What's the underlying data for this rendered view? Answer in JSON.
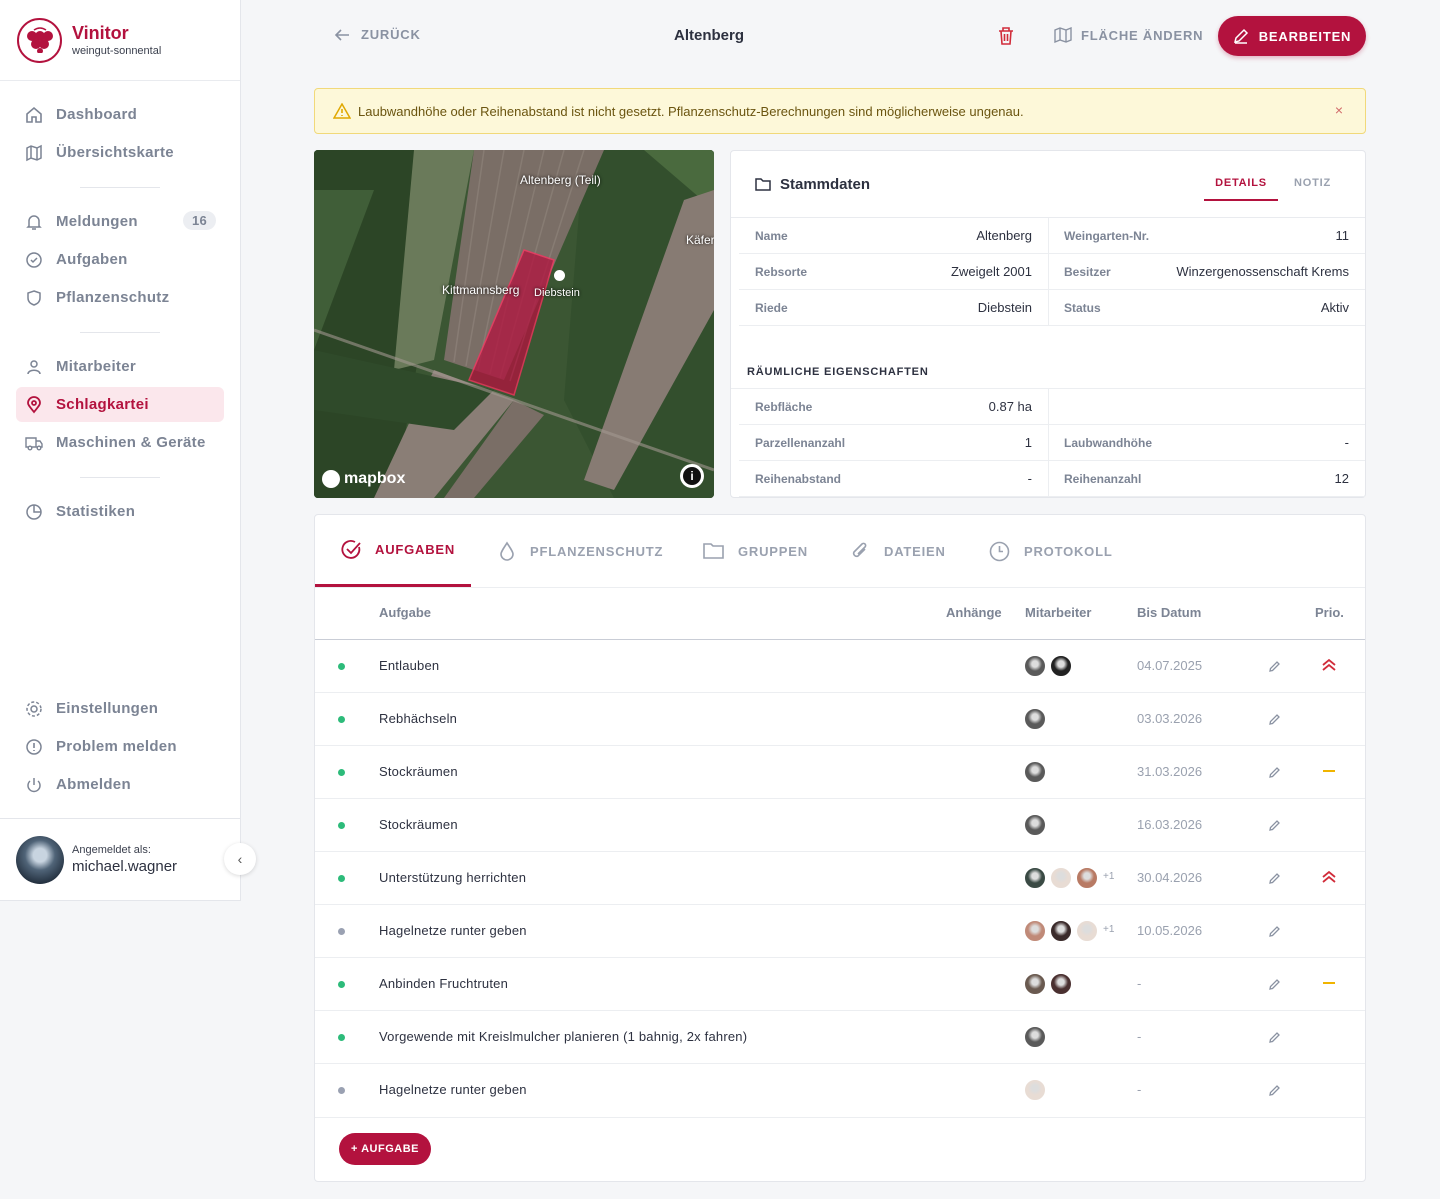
{
  "brand": {
    "name": "Vinitor",
    "sub": "weingut-sonnental"
  },
  "nav": {
    "dashboard": "Dashboard",
    "map": "Übersichtskarte",
    "meldungen": "Meldungen",
    "meldungen_count": "16",
    "aufgaben": "Aufgaben",
    "pflanzenschutz": "Pflanzenschutz",
    "mitarbeiter": "Mitarbeiter",
    "schlagkartei": "Schlagkartei",
    "maschinen": "Maschinen & Geräte",
    "statistiken": "Statistiken",
    "einstellungen": "Einstellungen",
    "problem": "Problem melden",
    "abmelden": "Abmelden"
  },
  "user": {
    "label": "Angemeldet als:",
    "name": "michael.wagner"
  },
  "topbar": {
    "back": "ZURÜCK",
    "title": "Altenberg",
    "change_area": "FLÄCHE ÄNDERN",
    "edit": "BEARBEITEN"
  },
  "warning": {
    "text": "Laubwandhöhe oder Reihenabstand ist nicht gesetzt. Pflanzenschutz-Berechnungen sind möglicherweise ungenau.",
    "close": "×"
  },
  "map": {
    "labels": {
      "altenberg": "Altenberg (Teil)",
      "kittmannsberg": "Kittmannsberg",
      "diebstein": "Diebstein",
      "kafer": "Käfer"
    },
    "attribution": "mapbox",
    "info": "i"
  },
  "stammdaten": {
    "title": "Stammdaten",
    "tab_details": "DETAILS",
    "tab_notiz": "NOTIZ",
    "rows_left": [
      {
        "k": "Name",
        "v": "Altenberg"
      },
      {
        "k": "Rebsorte",
        "v": "Zweigelt 2001"
      },
      {
        "k": "Riede",
        "v": "Diebstein"
      }
    ],
    "rows_right": [
      {
        "k": "Weingarten-Nr.",
        "v": "11"
      },
      {
        "k": "Besitzer",
        "v": "Winzergenossenschaft Krems"
      },
      {
        "k": "Status",
        "v": "Aktiv"
      }
    ],
    "spatial_title": "RÄUMLICHE EIGENSCHAFTEN",
    "spatial_left": [
      {
        "k": "Rebfläche",
        "v": "0.87 ha"
      },
      {
        "k": "Parzellenanzahl",
        "v": "1"
      },
      {
        "k": "Reihenabstand",
        "v": "-"
      }
    ],
    "spatial_right": [
      {
        "k": "",
        "v": ""
      },
      {
        "k": "Laubwandhöhe",
        "v": "-"
      },
      {
        "k": "Reihenanzahl",
        "v": "12"
      }
    ]
  },
  "tabs": {
    "aufgaben": "AUFGABEN",
    "pflanzenschutz": "PFLANZENSCHUTZ",
    "gruppen": "GRUPPEN",
    "dateien": "DATEIEN",
    "protokoll": "PROTOKOLL"
  },
  "table": {
    "headers": {
      "task": "Aufgabe",
      "attachments": "Anhänge",
      "staff": "Mitarbeiter",
      "due": "Bis Datum",
      "prio": "Prio."
    },
    "rows": [
      {
        "name": "Entlauben",
        "date": "04.07.2025",
        "status": "green",
        "prio": "high",
        "avatars": [
          "#5a5a5a",
          "#222222"
        ],
        "more": ""
      },
      {
        "name": "Rebhächseln",
        "date": "03.03.2026",
        "status": "green",
        "prio": "",
        "avatars": [
          "#5a5a5a"
        ],
        "more": ""
      },
      {
        "name": "Stockräumen",
        "date": "31.03.2026",
        "status": "green",
        "prio": "medium",
        "avatars": [
          "#5a5a5a"
        ],
        "more": ""
      },
      {
        "name": "Stockräumen",
        "date": "16.03.2026",
        "status": "green",
        "prio": "",
        "avatars": [
          "#5a5a5a"
        ],
        "more": ""
      },
      {
        "name": "Unterstützung herrichten",
        "date": "30.04.2026",
        "status": "green",
        "prio": "high",
        "avatars": [
          "#3a4a44",
          "#e8dcd4",
          "#b87a64"
        ],
        "more": "+1"
      },
      {
        "name": "Hagelnetze runter geben",
        "date": "10.05.2026",
        "status": "grey",
        "prio": "",
        "avatars": [
          "#c08a78",
          "#3a2a2a",
          "#e8dcd4"
        ],
        "more": "+1"
      },
      {
        "name": "Anbinden Fruchtruten",
        "date": "-",
        "status": "green",
        "prio": "medium",
        "avatars": [
          "#6a5a50",
          "#4a3030"
        ],
        "more": ""
      },
      {
        "name": "Vorgewende mit Kreislmulcher planieren (1 bahnig, 2x fahren)",
        "date": "-",
        "status": "green",
        "prio": "",
        "avatars": [
          "#5a5a5a"
        ],
        "more": ""
      },
      {
        "name": "Hagelnetze runter geben",
        "date": "-",
        "status": "grey",
        "prio": "",
        "avatars": [
          "#e8dcd4"
        ],
        "more": ""
      }
    ],
    "add": "+ AUFGABE"
  },
  "colors": {
    "accent": "#b3123e",
    "green": "#2dbb7a",
    "grey": "#9aa1b2",
    "prio_high": "#d12c3a",
    "prio_medium": "#f0b400"
  }
}
